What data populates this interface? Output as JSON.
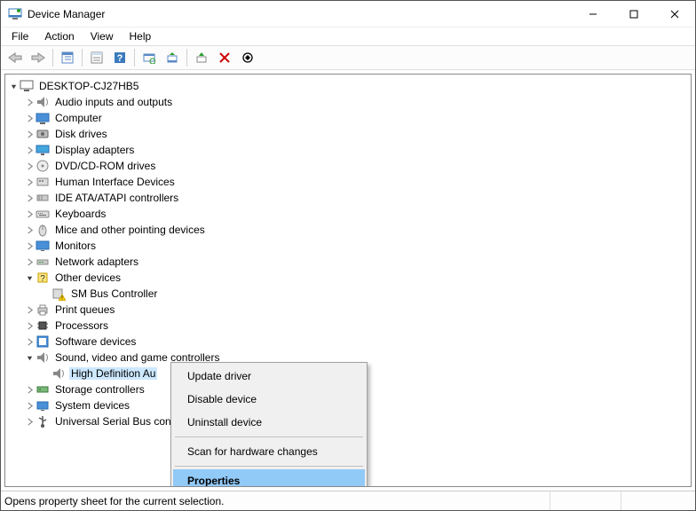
{
  "title": "Device Manager",
  "menu": {
    "file": "File",
    "action": "Action",
    "view": "View",
    "help": "Help"
  },
  "root": "DESKTOP-CJ27HB5",
  "categories": {
    "audio": "Audio inputs and outputs",
    "computer": "Computer",
    "disk": "Disk drives",
    "display": "Display adapters",
    "dvd": "DVD/CD-ROM drives",
    "hid": "Human Interface Devices",
    "ide": "IDE ATA/ATAPI controllers",
    "keyboards": "Keyboards",
    "mice": "Mice and other pointing devices",
    "monitors": "Monitors",
    "network": "Network adapters",
    "other": "Other devices",
    "other_child": "SM Bus Controller",
    "print": "Print queues",
    "processors": "Processors",
    "software": "Software devices",
    "sound": "Sound, video and game controllers",
    "sound_child": "High Definition Audio Device",
    "sound_child_cut": "High Definition Au",
    "storage": "Storage controllers",
    "system": "System devices",
    "usb": "Universal Serial Bus controllers",
    "usb_cut": "Universal Serial Bus con"
  },
  "ctx": {
    "update": "Update driver",
    "disable": "Disable device",
    "uninstall": "Uninstall device",
    "scan": "Scan for hardware changes",
    "properties": "Properties"
  },
  "status": "Opens property sheet for the current selection."
}
